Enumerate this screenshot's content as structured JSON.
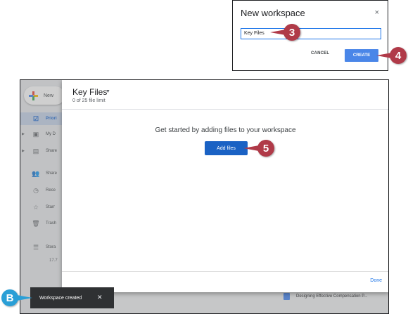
{
  "dialog": {
    "title": "New workspace",
    "close_glyph": "×",
    "input_value": "Key Files",
    "cancel_label": "CANCEL",
    "create_label": "CREATE"
  },
  "sidebar": {
    "new_label": "New",
    "items": [
      {
        "label": "Priori",
        "icon": "checkbox-icon",
        "glyph": "☑"
      },
      {
        "label": "My D",
        "icon": "drive-icon",
        "glyph": "▣"
      },
      {
        "label": "Share",
        "icon": "shared-drives-icon",
        "glyph": "▤"
      },
      {
        "label": "Share",
        "icon": "shared-with-me-icon",
        "glyph": "👥"
      },
      {
        "label": "Rece",
        "icon": "clock-icon",
        "glyph": "◷"
      },
      {
        "label": "Starr",
        "icon": "star-icon",
        "glyph": "☆"
      },
      {
        "label": "Trash",
        "icon": "trash-icon",
        "glyph": "🗑"
      },
      {
        "label": "Stora",
        "icon": "storage-icon",
        "glyph": "☰"
      }
    ],
    "storage_value": "17.7"
  },
  "panel": {
    "title": "Key Files",
    "subtitle": "0 of 25 file limit",
    "heading": "Get started by adding files to your workspace",
    "add_files_label": "Add files",
    "done_label": "Done"
  },
  "file_row": {
    "name": "Designing Effective Compensation P..."
  },
  "snackbar": {
    "message": "Workspace created",
    "close_glyph": "✕"
  },
  "markers": {
    "m3": "3",
    "m4": "4",
    "m5": "5",
    "mB": "B"
  },
  "colors": {
    "marker_red": "#b03a48",
    "marker_blue": "#2a9fd6",
    "accent": "#1a62c4"
  }
}
